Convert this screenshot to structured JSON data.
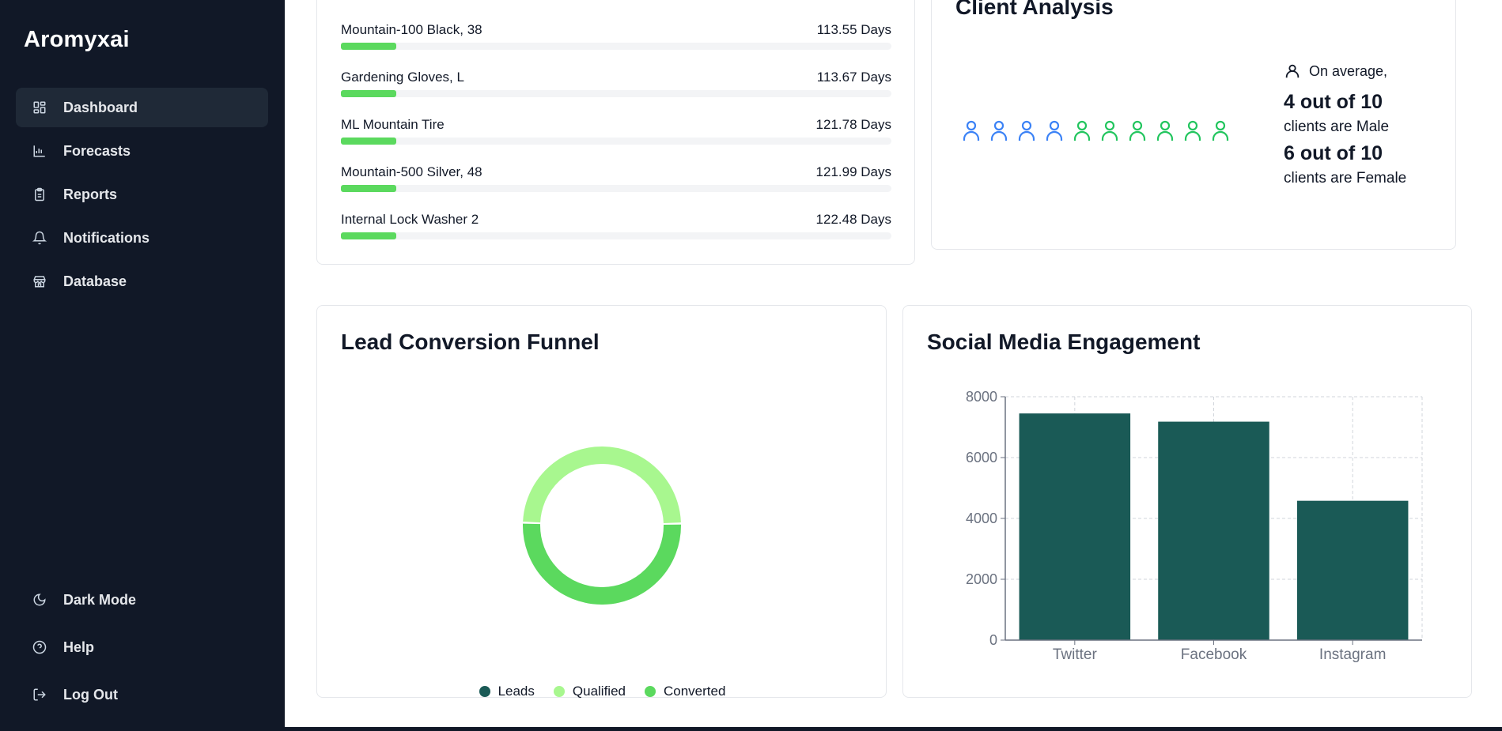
{
  "sidebar": {
    "brand": "Aromyxai",
    "items": [
      {
        "label": "Dashboard",
        "icon": "dashboard-icon",
        "active": true
      },
      {
        "label": "Forecasts",
        "icon": "bar-chart-icon"
      },
      {
        "label": "Reports",
        "icon": "clipboard-icon"
      },
      {
        "label": "Notifications",
        "icon": "bell-icon"
      },
      {
        "label": "Database",
        "icon": "store-icon"
      }
    ],
    "bottom_items": [
      {
        "label": "Dark Mode",
        "icon": "moon-icon"
      },
      {
        "label": "Help",
        "icon": "help-circle-icon"
      },
      {
        "label": "Log Out",
        "icon": "log-out-icon"
      }
    ]
  },
  "inventory": {
    "rows": [
      {
        "name": "Mountain-100 Black, 38",
        "value": "113.55 Days",
        "fill_pct": 10
      },
      {
        "name": "Gardening Gloves, L",
        "value": "113.67 Days",
        "fill_pct": 10
      },
      {
        "name": "ML Mountain Tire",
        "value": "121.78 Days",
        "fill_pct": 10
      },
      {
        "name": "Mountain-500 Silver, 48",
        "value": "121.99 Days",
        "fill_pct": 10
      },
      {
        "name": "Internal Lock Washer 2",
        "value": "122.48 Days",
        "fill_pct": 10
      }
    ]
  },
  "client_analysis": {
    "title": "Client Analysis",
    "intro": "On average,",
    "male_stat": "4 out of 10",
    "male_label": "clients are Male",
    "female_stat": "6 out of 10",
    "female_label": "clients are Female",
    "male_count": 4,
    "female_count": 6,
    "male_color": "#3b82f6",
    "female_color": "#22c55e"
  },
  "funnel": {
    "title": "Lead Conversion Funnel",
    "legend": [
      {
        "label": "Leads",
        "color": "#1a5a56"
      },
      {
        "label": "Qualified",
        "color": "#a8f78f"
      },
      {
        "label": "Converted",
        "color": "#5bd95e"
      }
    ]
  },
  "social": {
    "title": "Social Media Engagement"
  },
  "chart_data": [
    {
      "type": "pie",
      "title": "Lead Conversion Funnel",
      "categories": [
        "Leads",
        "Qualified",
        "Converted"
      ],
      "values": [
        0,
        49,
        51
      ],
      "colors": [
        "#1a5a56",
        "#a8f78f",
        "#5bd95e"
      ]
    },
    {
      "type": "bar",
      "title": "Social Media Engagement",
      "categories": [
        "Twitter",
        "Facebook",
        "Instagram"
      ],
      "values": [
        7450,
        7180,
        4580
      ],
      "ylim": [
        0,
        8000
      ],
      "yticks": [
        0,
        2000,
        4000,
        6000,
        8000
      ],
      "grid": true,
      "color": "#1a5a56"
    }
  ]
}
